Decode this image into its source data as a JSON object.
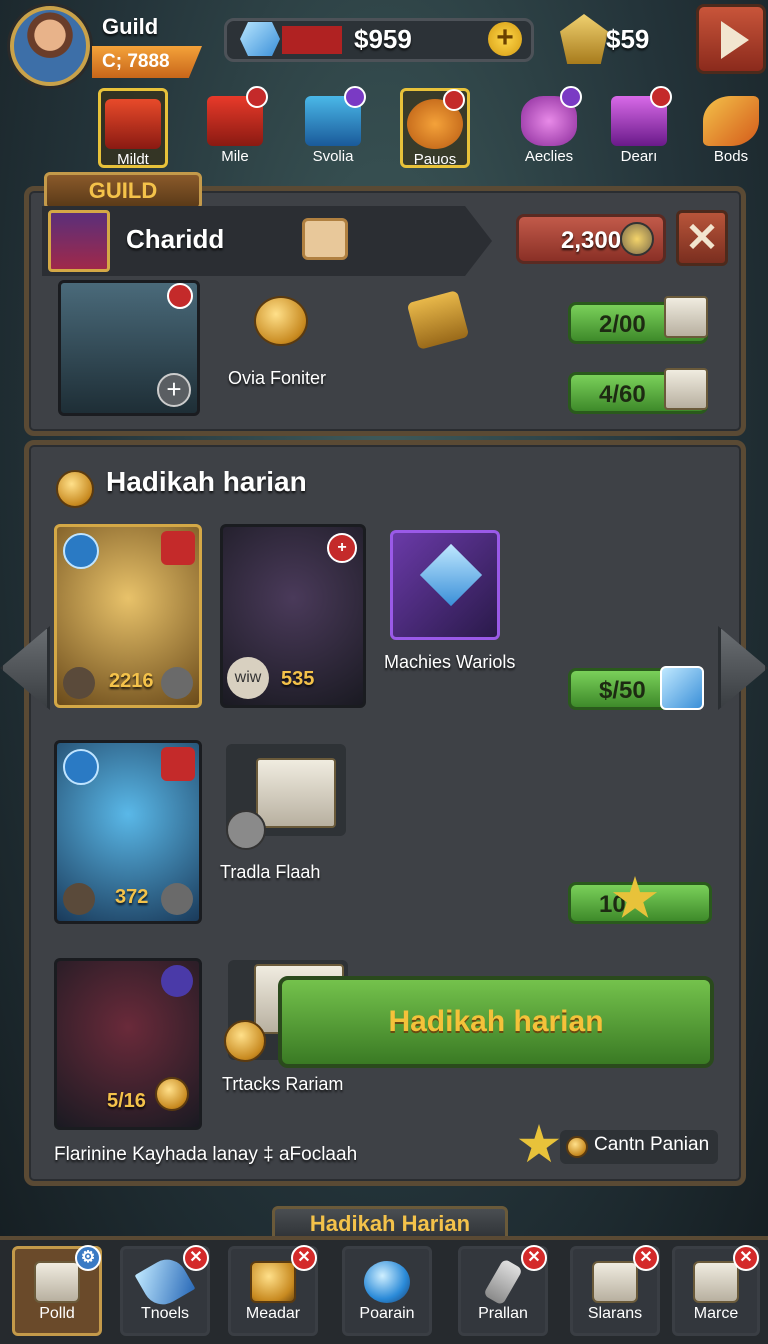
{
  "header": {
    "guild_label": "Guild",
    "guild_code": "C; 7888",
    "currency_gem": "$959",
    "currency_gold": "$59"
  },
  "categories": [
    {
      "label": "Mildt",
      "selected": true
    },
    {
      "label": "Mile"
    },
    {
      "label": "Svolia"
    },
    {
      "label": "Pauos",
      "selected": true
    },
    {
      "label": "Aeclies"
    },
    {
      "label": "Dearı"
    },
    {
      "label": "Bods"
    }
  ],
  "guild_panel": {
    "tab": "GUILD",
    "name": "Charidd",
    "resource": "2,300",
    "close": "✕",
    "reward_label": "Ovia Foniter",
    "progress": [
      "2/00",
      "4/60"
    ]
  },
  "daily": {
    "title": "Hadikah harian",
    "cards": [
      {
        "value": "2216"
      },
      {
        "left": "wiw",
        "value": "535"
      },
      {
        "value": "372"
      },
      {
        "value": "5/16"
      }
    ],
    "items": [
      {
        "label": "Machies Wariols",
        "price": "$/50"
      },
      {
        "label": "Tradla Flaah",
        "price": "10"
      },
      {
        "label": "Trtacks Rariam"
      }
    ],
    "main_button": "Hadikah harian",
    "footnote": "Flarinine Kayhada lanay ‡ aFoclaah",
    "corner_label": "Cantn Panian"
  },
  "footer_tab": "Hadikah Harian",
  "nav": [
    {
      "label": "Polld",
      "selected": true
    },
    {
      "label": "Tnoels",
      "badge": "✕"
    },
    {
      "label": "Meadar",
      "badge": "✕"
    },
    {
      "label": "Poarain"
    },
    {
      "label": "Prallan",
      "badge": "✕"
    },
    {
      "label": "Slarans",
      "badge": "✕"
    },
    {
      "label": "Marce",
      "badge": "✕"
    }
  ],
  "colors": {
    "accent_gold": "#f4c24a",
    "accent_green": "#5aa83a",
    "danger_red": "#c42a2a"
  }
}
